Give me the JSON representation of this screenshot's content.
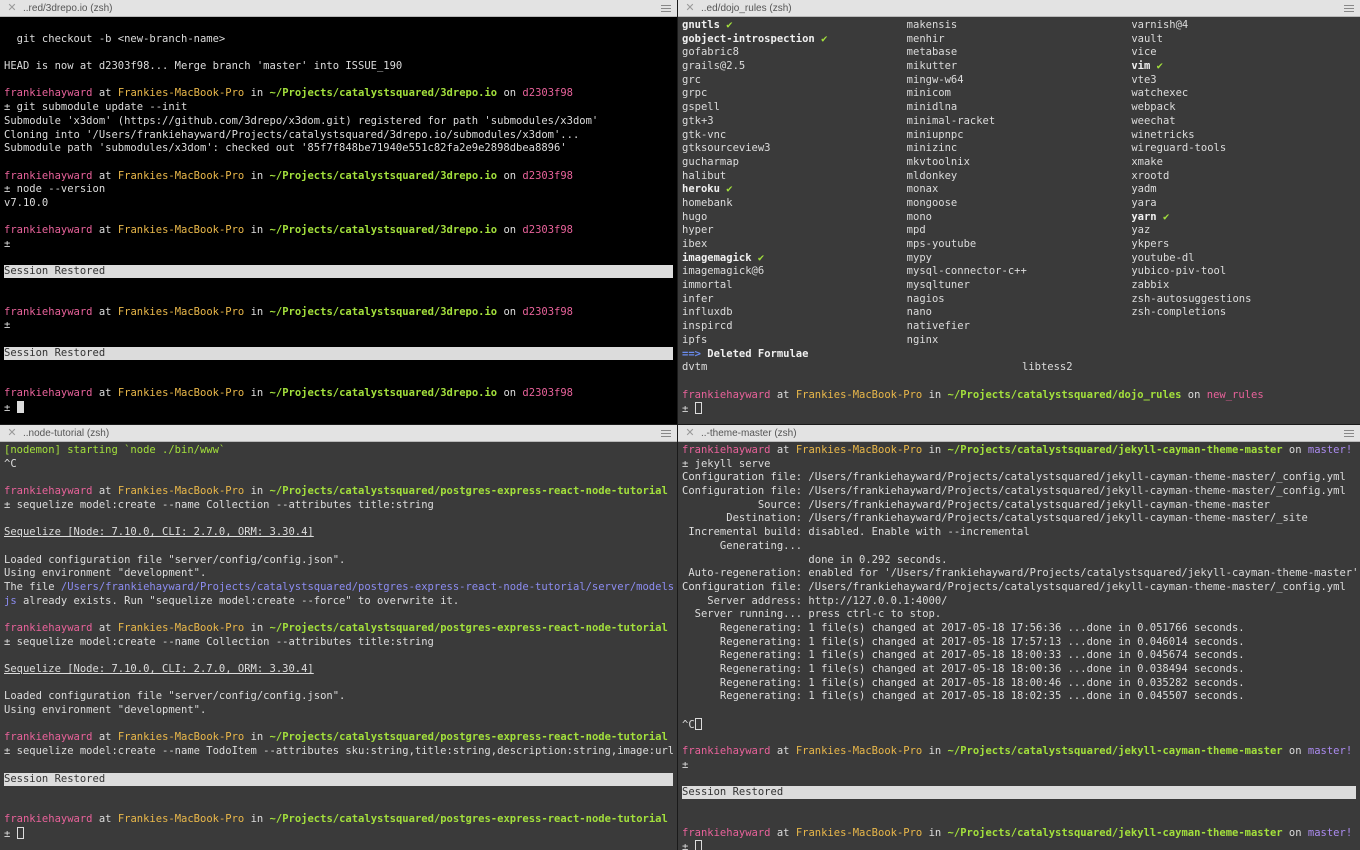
{
  "panes": {
    "tl": {
      "title": "..red/3drepo.io (zsh)",
      "lines": [
        {
          "text": ""
        },
        {
          "text": "  git checkout -b <new-branch-name>"
        },
        {
          "text": ""
        },
        {
          "text": "HEAD is now at d2303f98... Merge branch 'master' into ISSUE_190"
        },
        {
          "text": ""
        },
        {
          "prompt": true,
          "user": "frankiehayward",
          "at": " at ",
          "host": "Frankies-MacBook-Pro",
          "in": " in ",
          "path": "~/Projects/catalystsquared/3drepo.io",
          "on": " on ",
          "branch": "d2303f98",
          "branch_color": "#e8629a"
        },
        {
          "text": "± git submodule update --init"
        },
        {
          "text": "Submodule 'x3dom' (https://github.com/3drepo/x3dom.git) registered for path 'submodules/x3dom'"
        },
        {
          "text": "Cloning into '/Users/frankiehayward/Projects/catalystsquared/3drepo.io/submodules/x3dom'..."
        },
        {
          "text": "Submodule path 'submodules/x3dom': checked out '85f7f848be71940e551c82fa2e9e2898dbea8896'"
        },
        {
          "text": ""
        },
        {
          "prompt": true,
          "user": "frankiehayward",
          "at": " at ",
          "host": "Frankies-MacBook-Pro",
          "in": " in ",
          "path": "~/Projects/catalystsquared/3drepo.io",
          "on": " on ",
          "branch": "d2303f98",
          "branch_color": "#e8629a"
        },
        {
          "text": "± node --version"
        },
        {
          "text": "v7.10.0"
        },
        {
          "text": ""
        },
        {
          "prompt": true,
          "user": "frankiehayward",
          "at": " at ",
          "host": "Frankies-MacBook-Pro",
          "in": " in ",
          "path": "~/Projects/catalystsquared/3drepo.io",
          "on": " on ",
          "branch": "d2303f98",
          "branch_color": "#e8629a"
        },
        {
          "text": "±"
        },
        {
          "text": ""
        },
        {
          "session": "Session Restored"
        },
        {
          "text": ""
        },
        {
          "text": ""
        },
        {
          "prompt": true,
          "user": "frankiehayward",
          "at": " at ",
          "host": "Frankies-MacBook-Pro",
          "in": " in ",
          "path": "~/Projects/catalystsquared/3drepo.io",
          "on": " on ",
          "branch": "d2303f98",
          "branch_color": "#e8629a"
        },
        {
          "text": "±"
        },
        {
          "text": ""
        },
        {
          "session": "Session Restored"
        },
        {
          "text": ""
        },
        {
          "text": ""
        },
        {
          "prompt": true,
          "user": "frankiehayward",
          "at": " at ",
          "host": "Frankies-MacBook-Pro",
          "in": " in ",
          "path": "~/Projects/catalystsquared/3drepo.io",
          "on": " on ",
          "branch": "d2303f98",
          "branch_color": "#e8629a"
        },
        {
          "text": "± ",
          "cursor": "block"
        }
      ]
    },
    "tr": {
      "title": "..ed/dojo_rules (zsh)",
      "columns": [
        [
          {
            "name": "gnutls",
            "installed": true
          },
          {
            "name": "gobject-introspection",
            "installed": true
          },
          {
            "name": "gofabric8"
          },
          {
            "name": "grails@2.5"
          },
          {
            "name": "grc"
          },
          {
            "name": "grpc"
          },
          {
            "name": "gspell"
          },
          {
            "name": "gtk+3"
          },
          {
            "name": "gtk-vnc"
          },
          {
            "name": "gtksourceview3"
          },
          {
            "name": "gucharmap"
          },
          {
            "name": "halibut"
          },
          {
            "name": "heroku",
            "installed": true
          },
          {
            "name": "homebank"
          },
          {
            "name": "hugo"
          },
          {
            "name": "hyper"
          },
          {
            "name": "ibex"
          },
          {
            "name": "imagemagick",
            "installed": true
          },
          {
            "name": "imagemagick@6"
          },
          {
            "name": "immortal"
          },
          {
            "name": "infer"
          },
          {
            "name": "influxdb"
          },
          {
            "name": "inspircd"
          },
          {
            "name": "ipfs"
          }
        ],
        [
          {
            "name": "makensis"
          },
          {
            "name": "menhir"
          },
          {
            "name": "metabase"
          },
          {
            "name": "mikutter"
          },
          {
            "name": "mingw-w64"
          },
          {
            "name": "minicom"
          },
          {
            "name": "minidlna"
          },
          {
            "name": "minimal-racket"
          },
          {
            "name": "miniupnpc"
          },
          {
            "name": "minizinc"
          },
          {
            "name": "mkvtoolnix"
          },
          {
            "name": "mldonkey"
          },
          {
            "name": "monax"
          },
          {
            "name": "mongoose"
          },
          {
            "name": "mono"
          },
          {
            "name": "mpd"
          },
          {
            "name": "mps-youtube"
          },
          {
            "name": "mypy"
          },
          {
            "name": "mysql-connector-c++"
          },
          {
            "name": "mysqltuner"
          },
          {
            "name": "nagios"
          },
          {
            "name": "nano"
          },
          {
            "name": "nativefier"
          },
          {
            "name": "nginx"
          }
        ],
        [
          {
            "name": "varnish@4"
          },
          {
            "name": "vault"
          },
          {
            "name": "vice"
          },
          {
            "name": "vim",
            "installed": true
          },
          {
            "name": "vte3"
          },
          {
            "name": "watchexec"
          },
          {
            "name": "webpack"
          },
          {
            "name": "weechat"
          },
          {
            "name": "winetricks"
          },
          {
            "name": "wireguard-tools"
          },
          {
            "name": "xmake"
          },
          {
            "name": "xrootd"
          },
          {
            "name": "yadm"
          },
          {
            "name": "yara"
          },
          {
            "name": "yarn",
            "installed": true
          },
          {
            "name": "yaz"
          },
          {
            "name": "ykpers"
          },
          {
            "name": "youtube-dl"
          },
          {
            "name": "yubico-piv-tool"
          },
          {
            "name": "zabbix"
          },
          {
            "name": "zsh-autosuggestions"
          },
          {
            "name": "zsh-completions"
          },
          {
            "name": ""
          },
          {
            "name": ""
          }
        ]
      ],
      "check_glyph": "✔",
      "deleted_arrow": "==>",
      "deleted_header": "Deleted Formulae",
      "deleted": [
        "dvtm",
        "libtess2"
      ],
      "prompt": {
        "user": "frankiehayward",
        "at": " at ",
        "host": "Frankies-MacBook-Pro",
        "in": " in ",
        "path": "~/Projects/catalystsquared/dojo_rules",
        "on": " on ",
        "branch": "new_rules",
        "branch_color": "#e8629a"
      },
      "last_line": "± "
    },
    "bl": {
      "title": "..node-tutorial (zsh)",
      "lines": [
        {
          "text": "[nodemon] starting `node ./bin/www`",
          "color": "#a3e03c",
          "weight": "normal"
        },
        {
          "text": "^C"
        },
        {
          "text": ""
        },
        {
          "prompt": true,
          "user": "frankiehayward",
          "at": " at ",
          "host": "Frankies-MacBook-Pro",
          "in": " in ",
          "path": "~/Projects/catalystsquared/postgres-express-react-node-tutorial",
          "on": " on ",
          "branch": "master!",
          "branch_color": "#ab8bf0"
        },
        {
          "text": "± sequelize model:create --name Collection --attributes title:string"
        },
        {
          "text": ""
        },
        {
          "text": "Sequelize [Node: 7.10.0, CLI: 2.7.0, ORM: 3.30.4]",
          "underline": true
        },
        {
          "text": ""
        },
        {
          "text": "Loaded configuration file \"server/config/config.json\"."
        },
        {
          "text": "Using environment \"development\"."
        },
        {
          "prefix": "The file ",
          "link": "/Users/frankiehayward/Projects/catalystsquared/postgres-express-react-node-tutorial/server/models/collection."
        },
        {
          "link_prefix": "js",
          "text": " already exists. Run \"sequelize model:create --force\" to overwrite it."
        },
        {
          "text": ""
        },
        {
          "prompt": true,
          "user": "frankiehayward",
          "at": " at ",
          "host": "Frankies-MacBook-Pro",
          "in": " in ",
          "path": "~/Projects/catalystsquared/postgres-express-react-node-tutorial",
          "on": " on ",
          "branch": "master!",
          "branch_color": "#ab8bf0"
        },
        {
          "text": "± sequelize model:create --name Collection --attributes title:string"
        },
        {
          "text": ""
        },
        {
          "text": "Sequelize [Node: 7.10.0, CLI: 2.7.0, ORM: 3.30.4]",
          "underline": true
        },
        {
          "text": ""
        },
        {
          "text": "Loaded configuration file \"server/config/config.json\"."
        },
        {
          "text": "Using environment \"development\"."
        },
        {
          "text": ""
        },
        {
          "prompt": true,
          "user": "frankiehayward",
          "at": " at ",
          "host": "Frankies-MacBook-Pro",
          "in": " in ",
          "path": "~/Projects/catalystsquared/postgres-express-react-node-tutorial",
          "on": " on ",
          "branch": "master!",
          "branch_color": "#ab8bf0"
        },
        {
          "text": "± sequelize model:create --name TodoItem --attributes sku:string,title:string,description:string,image:url"
        },
        {
          "text": ""
        },
        {
          "session": "Session Restored"
        },
        {
          "text": ""
        },
        {
          "text": ""
        },
        {
          "prompt": true,
          "user": "frankiehayward",
          "at": " at ",
          "host": "Frankies-MacBook-Pro",
          "in": " in ",
          "path": "~/Projects/catalystsquared/postgres-express-react-node-tutorial",
          "on": " on ",
          "branch": "master!",
          "branch_color": "#ab8bf0"
        },
        {
          "text": "± ",
          "cursor": "outline"
        }
      ]
    },
    "br": {
      "title": "..-theme-master (zsh)",
      "lines": [
        {
          "prompt": true,
          "user": "frankiehayward",
          "at": " at ",
          "host": "Frankies-MacBook-Pro",
          "in": " in ",
          "path": "~/Projects/catalystsquared/jekyll-cayman-theme-master",
          "on": " on ",
          "branch": "master!",
          "branch_color": "#ab8bf0"
        },
        {
          "text": "± jekyll serve"
        },
        {
          "text": "Configuration file: /Users/frankiehayward/Projects/catalystsquared/jekyll-cayman-theme-master/_config.yml"
        },
        {
          "text": "Configuration file: /Users/frankiehayward/Projects/catalystsquared/jekyll-cayman-theme-master/_config.yml"
        },
        {
          "text": "            Source: /Users/frankiehayward/Projects/catalystsquared/jekyll-cayman-theme-master"
        },
        {
          "text": "       Destination: /Users/frankiehayward/Projects/catalystsquared/jekyll-cayman-theme-master/_site"
        },
        {
          "text": " Incremental build: disabled. Enable with --incremental"
        },
        {
          "text": "      Generating..."
        },
        {
          "text": "                    done in 0.292 seconds."
        },
        {
          "text": " Auto-regeneration: enabled for '/Users/frankiehayward/Projects/catalystsquared/jekyll-cayman-theme-master'"
        },
        {
          "text": "Configuration file: /Users/frankiehayward/Projects/catalystsquared/jekyll-cayman-theme-master/_config.yml"
        },
        {
          "text": "    Server address: http://127.0.0.1:4000/"
        },
        {
          "text": "  Server running... press ctrl-c to stop."
        },
        {
          "text": "      Regenerating: 1 file(s) changed at 2017-05-18 17:56:36 ...done in 0.051766 seconds."
        },
        {
          "text": "      Regenerating: 1 file(s) changed at 2017-05-18 17:57:13 ...done in 0.046014 seconds."
        },
        {
          "text": "      Regenerating: 1 file(s) changed at 2017-05-18 18:00:33 ...done in 0.045674 seconds."
        },
        {
          "text": "      Regenerating: 1 file(s) changed at 2017-05-18 18:00:36 ...done in 0.038494 seconds."
        },
        {
          "text": "      Regenerating: 1 file(s) changed at 2017-05-18 18:00:46 ...done in 0.035282 seconds."
        },
        {
          "text": "      Regenerating: 1 file(s) changed at 2017-05-18 18:02:35 ...done in 0.045507 seconds."
        },
        {
          "text": ""
        },
        {
          "text": "^C",
          "cursor": "outline"
        },
        {
          "text": ""
        },
        {
          "prompt": true,
          "user": "frankiehayward",
          "at": " at ",
          "host": "Frankies-MacBook-Pro",
          "in": " in ",
          "path": "~/Projects/catalystsquared/jekyll-cayman-theme-master",
          "on": " on ",
          "branch": "master!",
          "branch_color": "#ab8bf0"
        },
        {
          "text": "±"
        },
        {
          "text": ""
        },
        {
          "session": "Session Restored"
        },
        {
          "text": ""
        },
        {
          "text": ""
        },
        {
          "prompt": true,
          "user": "frankiehayward",
          "at": " at ",
          "host": "Frankies-MacBook-Pro",
          "in": " in ",
          "path": "~/Projects/catalystsquared/jekyll-cayman-theme-master",
          "on": " on ",
          "branch": "master!",
          "branch_color": "#ab8bf0"
        },
        {
          "text": "± ",
          "cursor": "outline"
        }
      ]
    }
  },
  "icons": {
    "close": "close-icon",
    "menu": "hamburger-menu-icon"
  },
  "close_glyph": "✕",
  "colors": {
    "user": "#e8629a",
    "host": "#eab84a",
    "path": "#a3e03c",
    "branch_hash": "#e8629a",
    "branch_master": "#ab8bf0",
    "dark_bg": "#000000",
    "gray_bg": "#3a3a3a",
    "session_bar": "#dcdcdc"
  }
}
